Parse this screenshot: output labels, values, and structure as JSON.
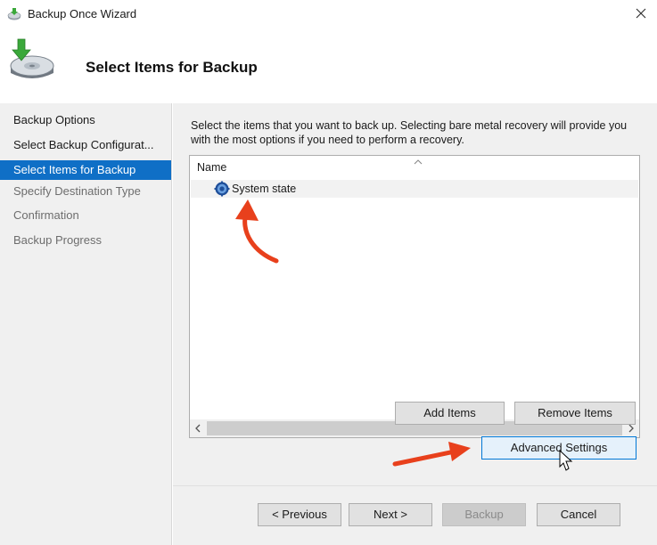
{
  "window": {
    "title": "Backup Once Wizard",
    "icons": {
      "app": "backup-app-icon",
      "close": "close-icon",
      "header": "backup-disk-icon"
    }
  },
  "header": {
    "title": "Select Items for Backup"
  },
  "sidebar": {
    "items": [
      {
        "label": "Backup Options",
        "state": "done"
      },
      {
        "label": "Select Backup Configurat...",
        "state": "done"
      },
      {
        "label": "Select Items for Backup",
        "state": "active"
      },
      {
        "label": "Specify Destination Type",
        "state": "todo"
      },
      {
        "label": "Confirmation",
        "state": "todo"
      },
      {
        "label": "Backup Progress",
        "state": "todo"
      }
    ]
  },
  "main": {
    "instructions": "Select the items that you want to back up. Selecting bare metal recovery will provide you with the most options if you need to perform a recovery.",
    "list": {
      "column_header": "Name",
      "rows": [
        {
          "label": "System state",
          "icon": "system-state-gear-icon"
        }
      ]
    },
    "buttons": {
      "add_items": "Add Items",
      "remove_items": "Remove Items",
      "advanced_settings": "Advanced Settings"
    }
  },
  "footer": {
    "previous": "< Previous",
    "next": "Next >",
    "backup": "Backup",
    "cancel": "Cancel"
  },
  "colors": {
    "active_nav": "#0f6fc6",
    "annotation_arrow": "#e8401c",
    "focus_border": "#0078d7"
  }
}
